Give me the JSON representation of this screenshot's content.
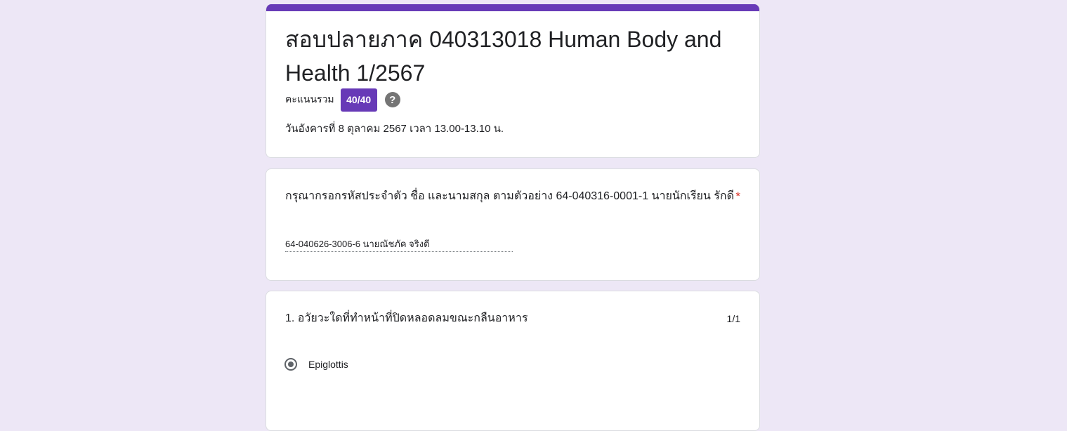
{
  "header": {
    "title": "สอบปลายภาค 040313018 Human Body and Health 1/2567",
    "score_label": "คะแนนรวม",
    "score_value": "40/40",
    "help_glyph": "?",
    "description": "วันอังคารที่ 8 ตุลาคม 2567 เวลา 13.00-13.10 น."
  },
  "identity_question": {
    "text": "กรุณากรอกรหัสประจำตัว ชื่อ และนามสกุล ตามตัวอย่าง  64-040316-0001-1 นายนักเรียน รักดี",
    "required_mark": "*",
    "answer": "64-040626-3006-6 นายณัชภัค จริงดี"
  },
  "questions": [
    {
      "title": "1. อวัยวะใดที่ทำหน้าที่ปิดหลอดลมขณะกลืนอาหาร",
      "points": "1/1",
      "selected_option": "Epiglottis"
    }
  ],
  "colors": {
    "background": "#ede7f6",
    "accent": "#673ab7",
    "required": "#d93025"
  },
  "icons": [
    "help-icon",
    "radio-selected-icon"
  ]
}
